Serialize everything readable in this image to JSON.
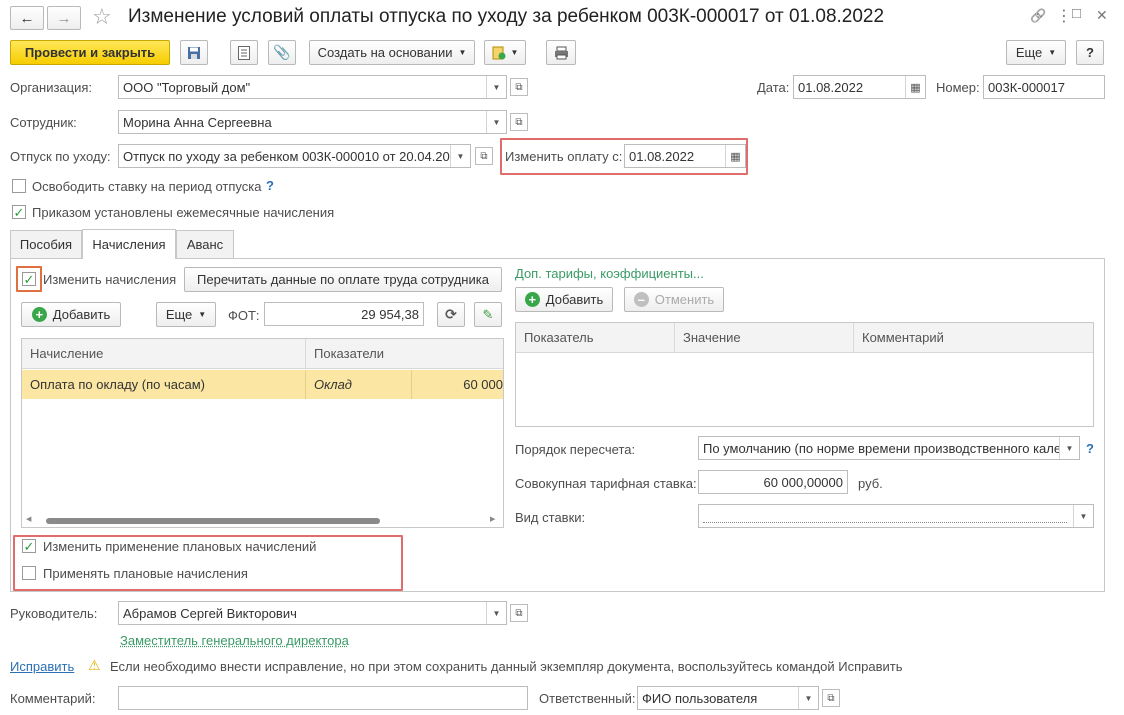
{
  "header": {
    "title": "Изменение условий оплаты отпуска по уходу за ребенком 003К-000017 от 01.08.2022",
    "back_icon": "←",
    "forward_icon": "→",
    "star_icon": "☆",
    "link_icon": "🔗",
    "more_icon": "⋮",
    "restore_icon": "□",
    "close_icon": "✕"
  },
  "toolbar": {
    "post_close": "Провести и закрыть",
    "create_based": "Создать на основании",
    "more": "Еще",
    "help": "?"
  },
  "form": {
    "org_label": "Организация:",
    "org_value": "ООО \"Торговый дом\"",
    "date_label": "Дата:",
    "date_value": "01.08.2022",
    "number_label": "Номер:",
    "number_value": "003К-000017",
    "employee_label": "Сотрудник:",
    "employee_value": "Морина Анна Сергеевна",
    "leave_label": "Отпуск по уходу:",
    "leave_value": "Отпуск по уходу за ребенком 003К-000010 от 20.04.20",
    "change_pay_label": "Изменить оплату с:",
    "change_pay_value": "01.08.2022",
    "free_rate_label": "Освободить ставку на период отпуска",
    "free_rate_help": "?",
    "monthly_label": "Приказом установлены ежемесячные начисления"
  },
  "tabs": [
    "Пособия",
    "Начисления",
    "Аванс"
  ],
  "accruals": {
    "change_label": "Изменить начисления",
    "reread_btn": "Перечитать данные по оплате труда сотрудника",
    "add_btn": "Добавить",
    "more_btn": "Еще",
    "fot_label": "ФОТ:",
    "fot_value": "29 954,38",
    "col_accrual": "Начисление",
    "col_indicators": "Показатели",
    "row_accrual": "Оплата по окладу (по часам)",
    "row_indicator": "Оклад",
    "row_value": "60 000",
    "plan_change_label": "Изменить применение плановых начислений",
    "plan_apply_label": "Применять плановые начисления"
  },
  "tariffs": {
    "link": "Доп. тарифы, коэффициенты...",
    "add_btn": "Добавить",
    "cancel_btn": "Отменить",
    "col_indicator": "Показатель",
    "col_value": "Значение",
    "col_comment": "Комментарий",
    "recalc_label": "Порядок пересчета:",
    "recalc_value": "По умолчанию (по норме времени производственного кале",
    "recalc_help": "?",
    "total_rate_label": "Совокупная тарифная ставка:",
    "total_rate_value": "60 000,00000",
    "rub": "руб.",
    "rate_type_label": "Вид ставки:",
    "rate_type_value": ""
  },
  "footer": {
    "manager_label": "Руководитель:",
    "manager_value": "Абрамов Сергей Викторович",
    "manager_position": "Заместитель генерального директора",
    "fix_link": "Исправить",
    "fix_note": "Если необходимо внести исправление, но при этом сохранить данный экземпляр документа, воспользуйтесь командой Исправить",
    "comment_label": "Комментарий:",
    "comment_value": "",
    "responsible_label": "Ответственный:",
    "responsible_value": "ФИО пользователя"
  },
  "colors": {
    "accent_yellow": "#f6cd00",
    "highlight_red": "#e06c6c",
    "row_selected": "#fbe7a3",
    "link_green": "#3a9a66",
    "link_blue": "#2b6fb5",
    "check_green": "#2a9d3a"
  }
}
